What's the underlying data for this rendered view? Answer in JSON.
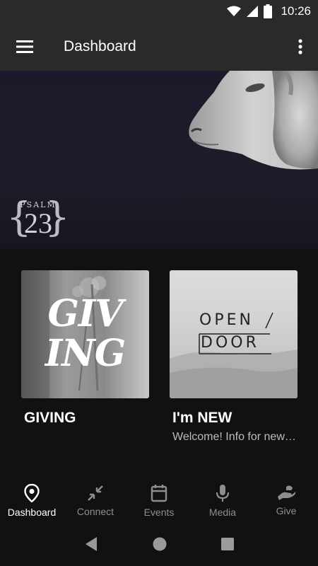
{
  "status_bar": {
    "time": "10:26",
    "icons": [
      "wifi-icon",
      "cell-signal-icon",
      "battery-icon"
    ]
  },
  "app_bar": {
    "title": "Dashboard",
    "menu_icon": "hamburger-menu-icon",
    "overflow_icon": "more-vertical-icon"
  },
  "hero": {
    "logo_word": "PSALM",
    "logo_number": "23"
  },
  "cards": [
    {
      "image_text": [
        "GIV",
        "ING"
      ],
      "title": "GIVING",
      "subtitle": ""
    },
    {
      "image_text_top": "OPEN",
      "image_text_bottom": "DOOR",
      "title": "I'm NEW",
      "subtitle": "Welcome! Info for new visitors"
    }
  ],
  "bottom_nav": {
    "items": [
      {
        "label": "Dashboard",
        "icon": "location-pin-icon",
        "active": true
      },
      {
        "label": "Connect",
        "icon": "arrows-inward-icon",
        "active": false
      },
      {
        "label": "Events",
        "icon": "calendar-icon",
        "active": false
      },
      {
        "label": "Media",
        "icon": "microphone-icon",
        "active": false
      },
      {
        "label": "Give",
        "icon": "giving-hand-icon",
        "active": false
      }
    ]
  },
  "system_nav": {
    "icons": [
      "back-icon",
      "home-icon",
      "recents-icon"
    ]
  },
  "colors": {
    "app_bar": "#2a2a2a",
    "background": "#111111",
    "active_nav": "#ffffff",
    "inactive_nav": "#8e8e8e"
  }
}
